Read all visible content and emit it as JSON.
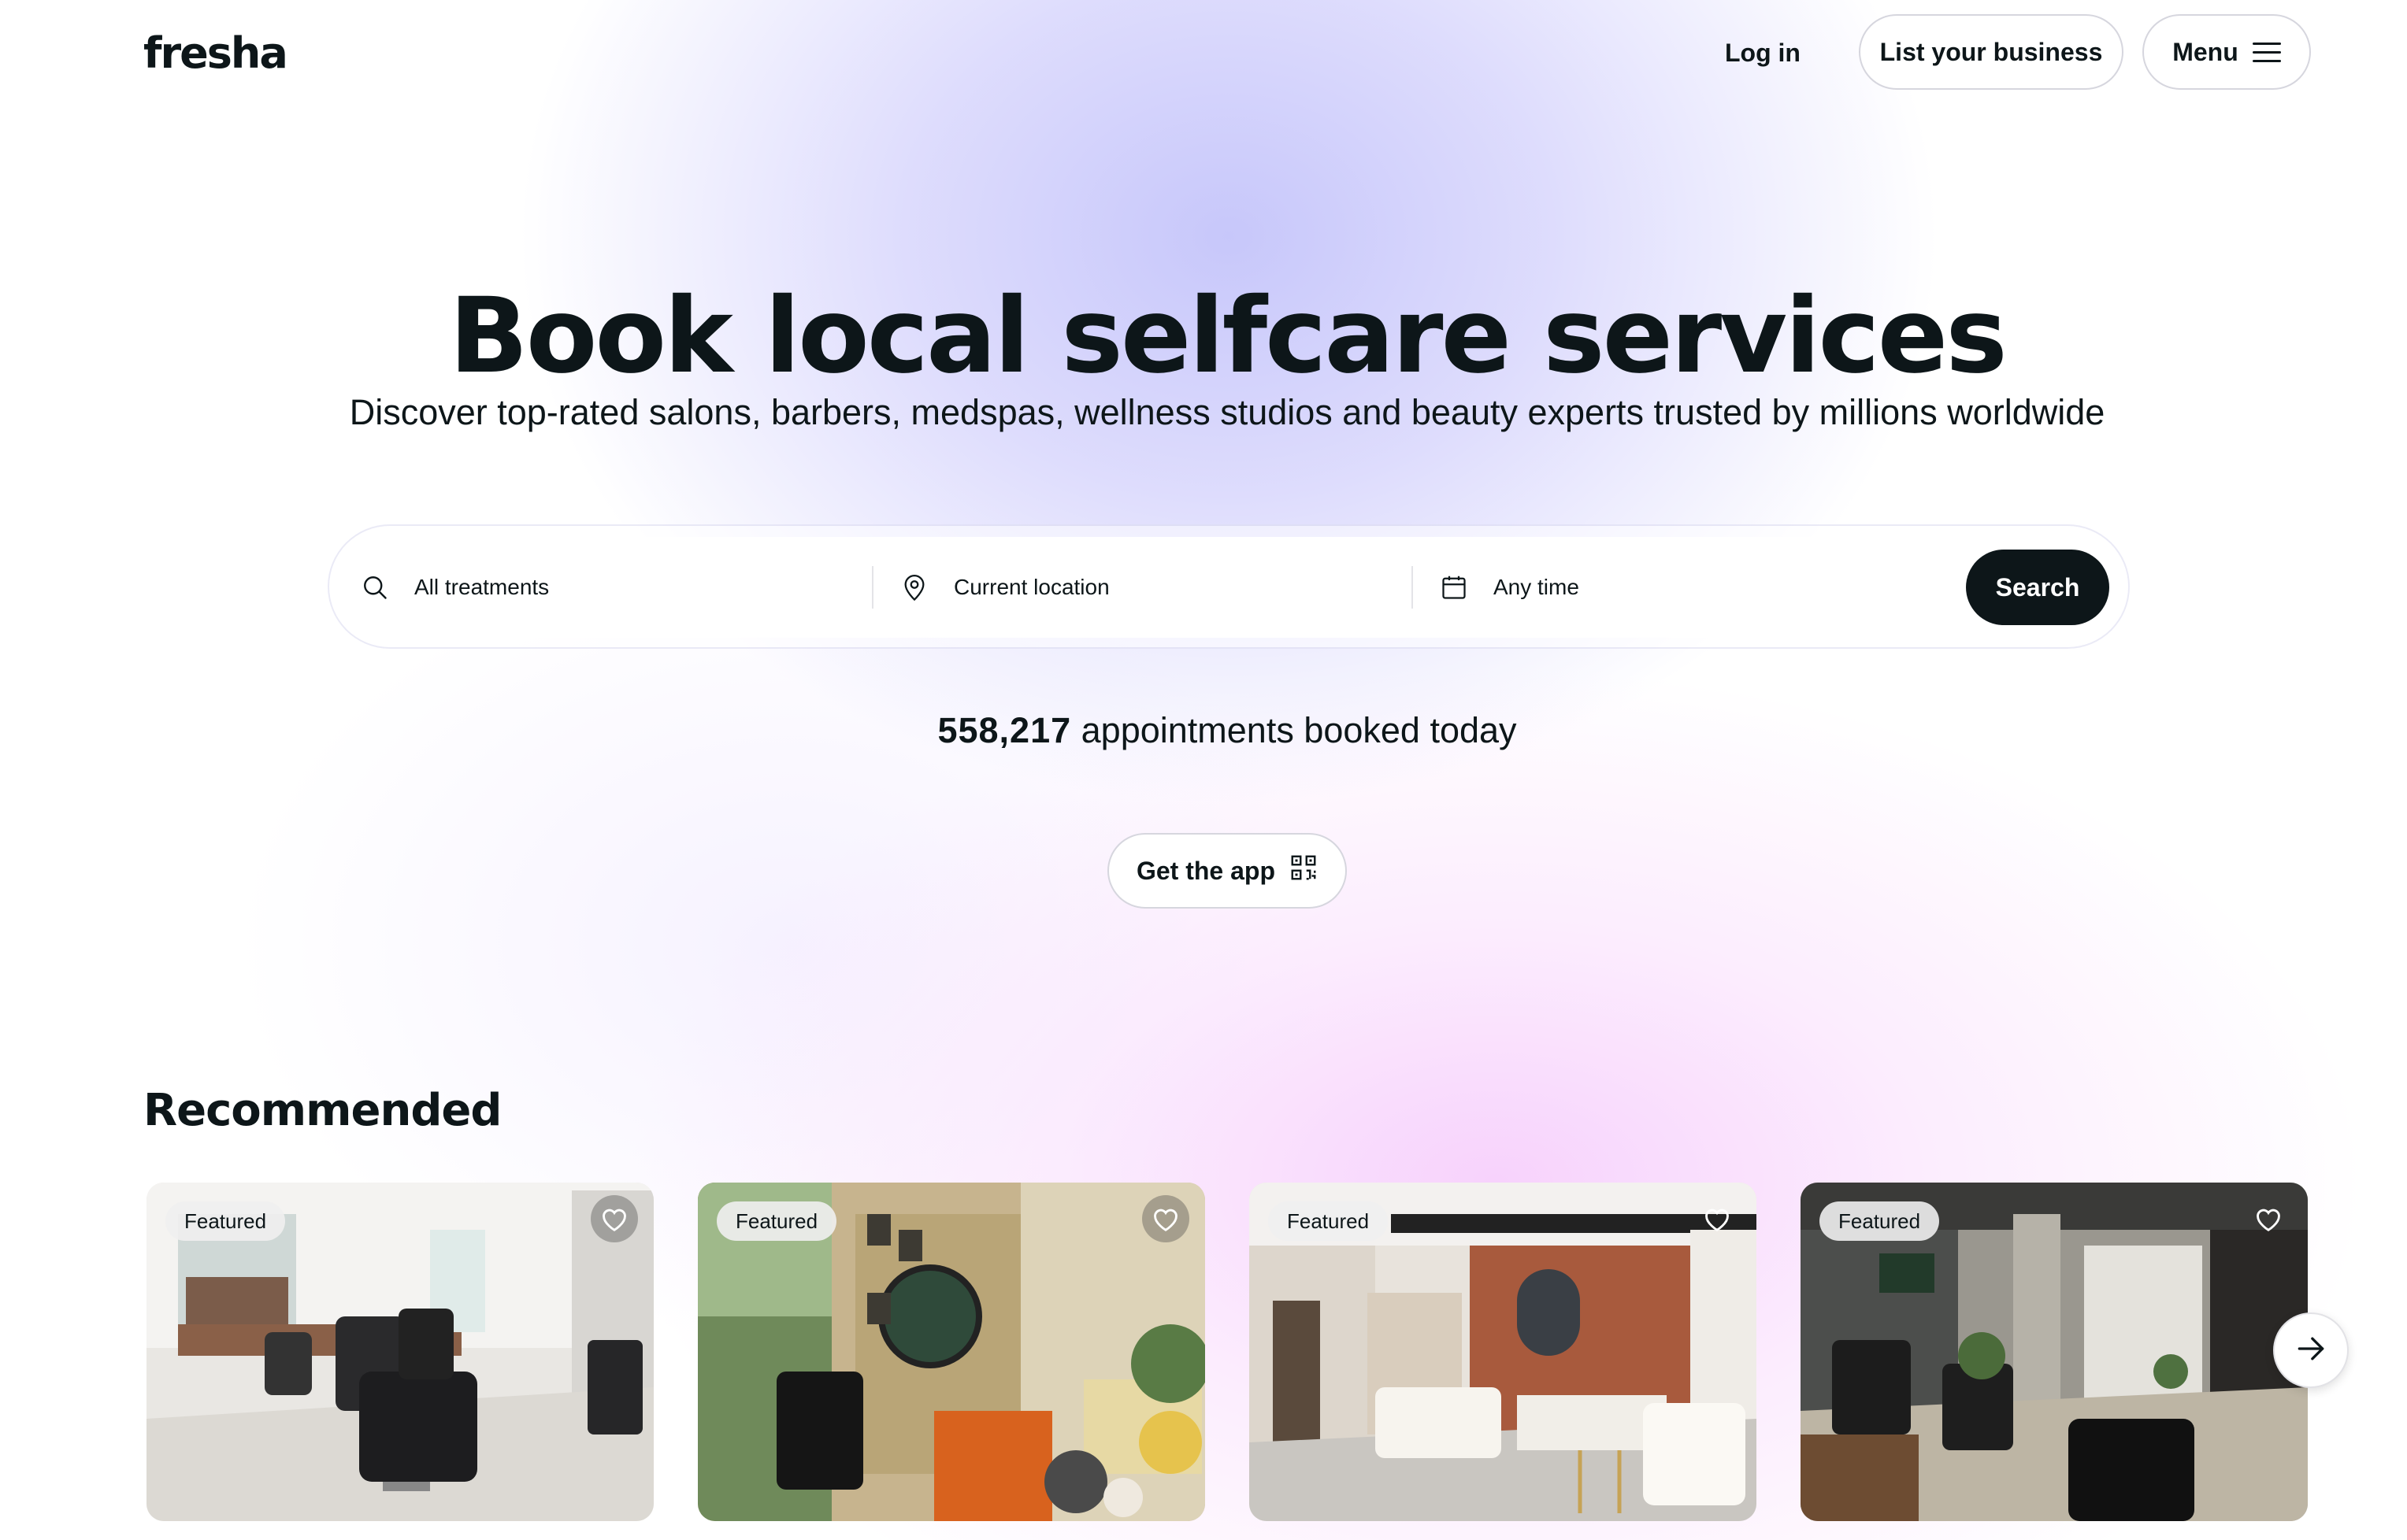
{
  "header": {
    "logo": "fresha",
    "login": "Log in",
    "list_business": "List your business",
    "menu": "Menu"
  },
  "hero": {
    "title": "Book local selfcare services",
    "subtitle": "Discover top-rated salons, barbers, medspas, wellness studios and beauty experts trusted by millions worldwide"
  },
  "search": {
    "treatments": "All treatments",
    "location": "Current location",
    "time": "Any time",
    "button": "Search"
  },
  "stats": {
    "count": "558,217",
    "label": "appointments booked today"
  },
  "app_button": "Get the app",
  "recommended": {
    "title": "Recommended",
    "cards": [
      {
        "badge": "Featured"
      },
      {
        "badge": "Featured"
      },
      {
        "badge": "Featured"
      },
      {
        "badge": "Featured"
      }
    ]
  },
  "colors": {
    "text": "#0d1619",
    "primary_button": "#0d1619",
    "hero_lavender": "#c4c4fa",
    "hero_pink": "#f6cdfc"
  },
  "icons": [
    "search-icon",
    "location-pin-icon",
    "calendar-icon",
    "qr-code-icon",
    "heart-icon",
    "arrow-right-icon",
    "hamburger-icon"
  ]
}
